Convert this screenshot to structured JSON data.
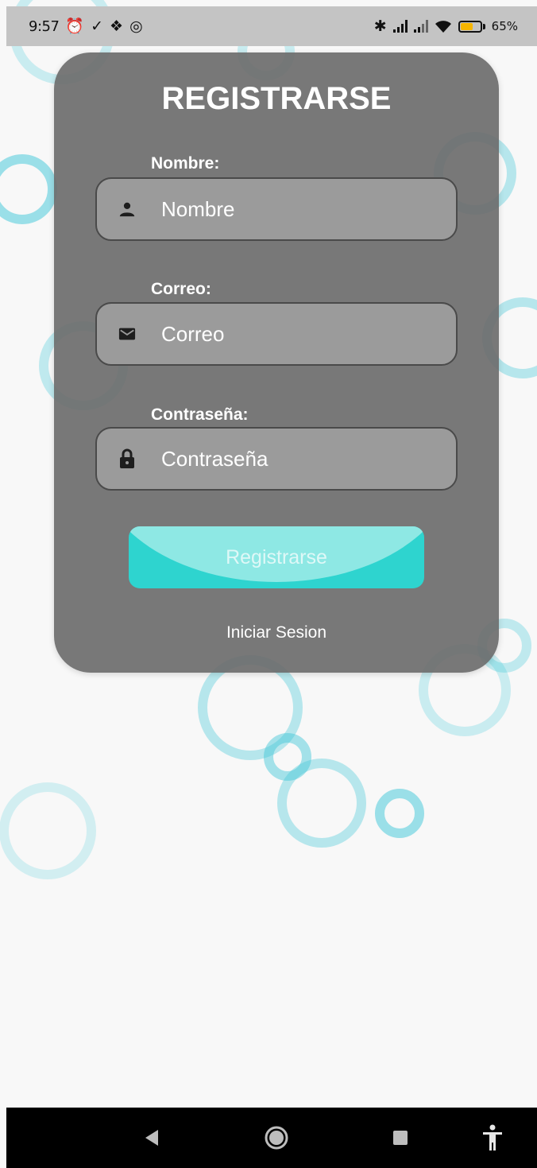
{
  "status_bar": {
    "time": "9:57",
    "battery_percent": "65%",
    "battery_level": 0.65
  },
  "form": {
    "title": "REGISTRARSE",
    "name_label": "Nombre:",
    "name_placeholder": "Nombre",
    "email_label": "Correo:",
    "email_placeholder": "Correo",
    "password_label": "Contraseña:",
    "password_placeholder": "Contraseña",
    "submit_label": "Registrarse",
    "login_link": "Iniciar Sesion"
  },
  "icons": {
    "name_field": "person-icon",
    "email_field": "mail-icon",
    "password_field": "lock-icon"
  },
  "colors": {
    "accent": "#2ed4cf",
    "card": "#6c6c6c",
    "bubble": "#3cc6d8"
  }
}
